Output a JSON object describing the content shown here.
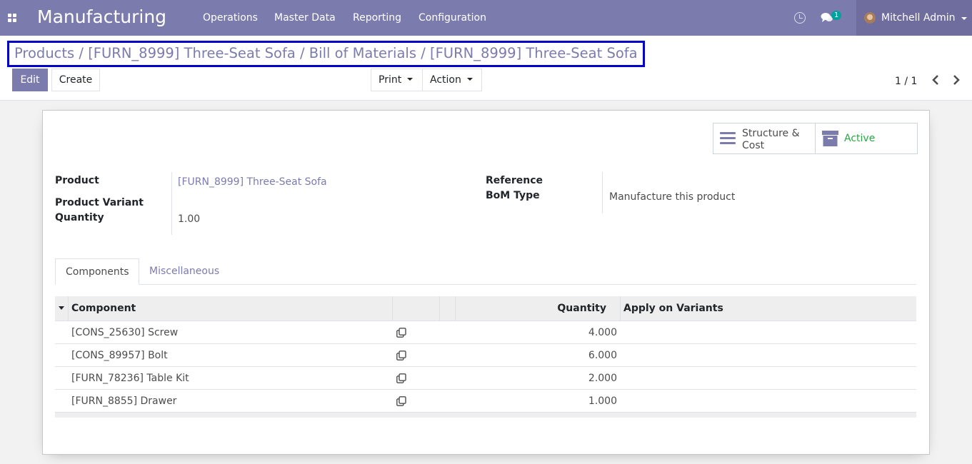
{
  "navbar": {
    "app_title": "Manufacturing",
    "menus": [
      "Operations",
      "Master Data",
      "Reporting",
      "Configuration"
    ],
    "chat_count": "1",
    "user_name": "Mitchell Admin"
  },
  "breadcrumb": {
    "items": [
      "Products",
      "[FURN_8999] Three-Seat Sofa",
      "Bill of Materials",
      "[FURN_8999] Three-Seat Sofa"
    ],
    "separator": "/"
  },
  "toolbar": {
    "edit_label": "Edit",
    "create_label": "Create",
    "print_label": "Print",
    "action_label": "Action",
    "pager": "1 / 1"
  },
  "stat_buttons": {
    "structure_label": "Structure &",
    "structure_label2": "Cost",
    "active_label": "Active"
  },
  "form": {
    "product_label": "Product",
    "product_value": "[FURN_8999] Three-Seat Sofa",
    "variant_label": "Product Variant",
    "quantity_label": "Quantity",
    "quantity_value": "1.00",
    "reference_label": "Reference",
    "bom_type_label": "BoM Type",
    "bom_type_value": "Manufacture this product"
  },
  "tabs": [
    "Components",
    "Miscellaneous"
  ],
  "table": {
    "headers": {
      "component": "Component",
      "quantity": "Quantity",
      "apply": "Apply on Variants"
    },
    "rows": [
      {
        "component": "[CONS_25630] Screw",
        "quantity": "4.000"
      },
      {
        "component": "[CONS_89957] Bolt",
        "quantity": "6.000"
      },
      {
        "component": "[FURN_78236] Table Kit",
        "quantity": "2.000"
      },
      {
        "component": "[FURN_8855] Drawer",
        "quantity": "1.000"
      }
    ]
  },
  "colors": {
    "brand": "#7c7bad",
    "active": "#28a745",
    "highlight": "#0000c8"
  }
}
